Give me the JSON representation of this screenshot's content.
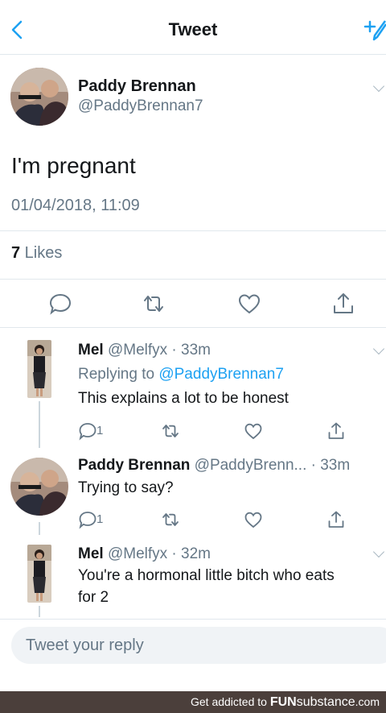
{
  "header": {
    "title": "Tweet"
  },
  "tweet": {
    "author_name": "Paddy Brennan",
    "author_handle": "@PaddyBrennan7",
    "text": "I'm pregnant",
    "timestamp": "01/04/2018, 11:09",
    "likes_count": "7",
    "likes_label": " Likes"
  },
  "replies": [
    {
      "name": "Mel",
      "handle": "@Melfyx",
      "time": " · 33m",
      "replying_label": "Replying to ",
      "replying_to": "@PaddyBrennan7",
      "text": "This explains a lot to be honest",
      "reply_count": "1"
    },
    {
      "name": "Paddy Brennan",
      "handle": "@PaddyBrenn...",
      "time": " · 33m",
      "text": "Trying to say?",
      "reply_count": "1"
    },
    {
      "name": "Mel",
      "handle": "@Melfyx",
      "time": " · 32m",
      "text_line1": "You're a hormonal little bitch who eats",
      "text_line2": "for 2"
    }
  ],
  "reply_box": {
    "placeholder": "Tweet your reply"
  },
  "footer": {
    "prefix": "Get addicted to ",
    "brand_bold": "FUN",
    "brand_rest": "substance",
    "suffix": ".com"
  },
  "colors": {
    "accent": "#1da1f2",
    "secondary_text": "#657786",
    "divider": "#e1e8ed"
  }
}
